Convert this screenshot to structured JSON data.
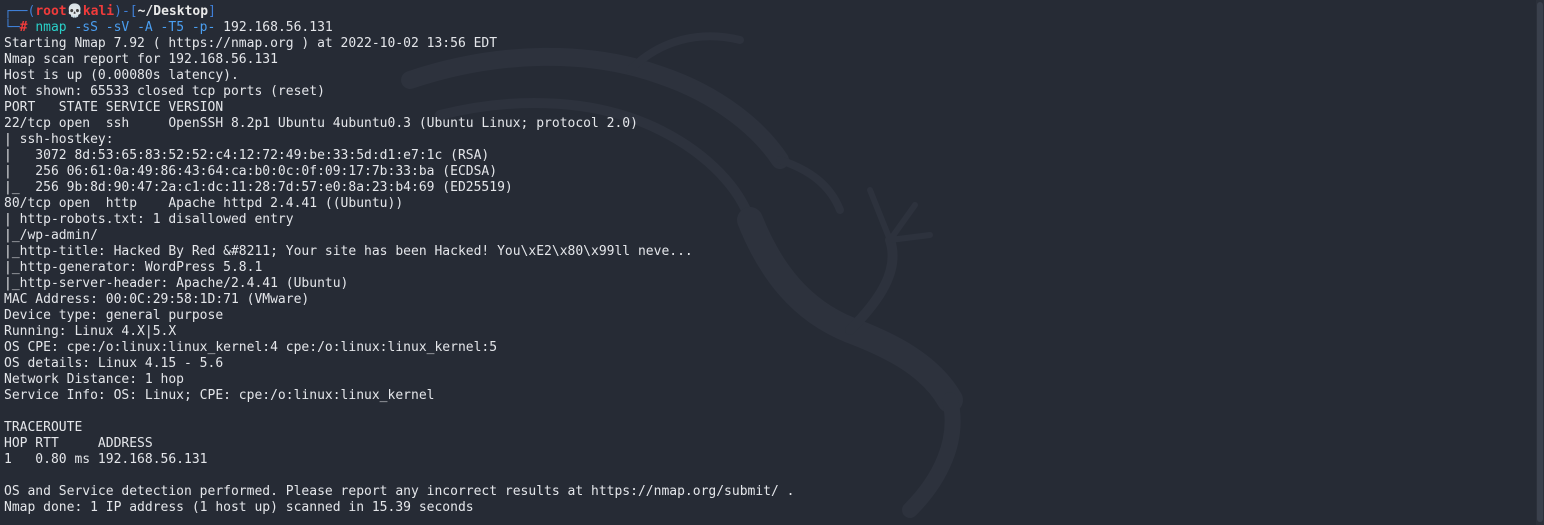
{
  "prompt": {
    "corner_top": "┌──(",
    "user": "root",
    "skull": "💀",
    "host": "kali",
    "separator": ")-[",
    "path": "~/Desktop",
    "close": "]",
    "corner_bottom": "└─",
    "symbol": "# ",
    "cmd_name": "nmap",
    "cmd_args": " -sS -sV -A -T5 -p-",
    "cmd_host": " 192.168.56.131"
  },
  "output": [
    "Starting Nmap 7.92 ( https://nmap.org ) at 2022-10-02 13:56 EDT",
    "Nmap scan report for 192.168.56.131",
    "Host is up (0.00080s latency).",
    "Not shown: 65533 closed tcp ports (reset)",
    "PORT   STATE SERVICE VERSION",
    "22/tcp open  ssh     OpenSSH 8.2p1 Ubuntu 4ubuntu0.3 (Ubuntu Linux; protocol 2.0)",
    "| ssh-hostkey: ",
    "|   3072 8d:53:65:83:52:52:c4:12:72:49:be:33:5d:d1:e7:1c (RSA)",
    "|   256 06:61:0a:49:86:43:64:ca:b0:0c:0f:09:17:7b:33:ba (ECDSA)",
    "|_  256 9b:8d:90:47:2a:c1:dc:11:28:7d:57:e0:8a:23:b4:69 (ED25519)",
    "80/tcp open  http    Apache httpd 2.4.41 ((Ubuntu))",
    "| http-robots.txt: 1 disallowed entry ",
    "|_/wp-admin/",
    "|_http-title: Hacked By Red &#8211; Your site has been Hacked! You\\xE2\\x80\\x99ll neve...",
    "|_http-generator: WordPress 5.8.1",
    "|_http-server-header: Apache/2.4.41 (Ubuntu)",
    "MAC Address: 00:0C:29:58:1D:71 (VMware)",
    "Device type: general purpose",
    "Running: Linux 4.X|5.X",
    "OS CPE: cpe:/o:linux:linux_kernel:4 cpe:/o:linux:linux_kernel:5",
    "OS details: Linux 4.15 - 5.6",
    "Network Distance: 1 hop",
    "Service Info: OS: Linux; CPE: cpe:/o:linux:linux_kernel",
    "",
    "TRACEROUTE",
    "HOP RTT     ADDRESS",
    "1   0.80 ms 192.168.56.131",
    "",
    "OS and Service detection performed. Please report any incorrect results at https://nmap.org/submit/ .",
    "Nmap done: 1 IP address (1 host up) scanned in 15.39 seconds"
  ],
  "colors": {
    "background": "#262b35",
    "text": "#e4e6ea",
    "prompt_blue": "#3f7fd6",
    "prompt_red": "#ef3b3b",
    "command": "#29d0c8",
    "args": "#4a9ef0"
  },
  "icons": {
    "watermark": "kali-dragon-icon"
  }
}
